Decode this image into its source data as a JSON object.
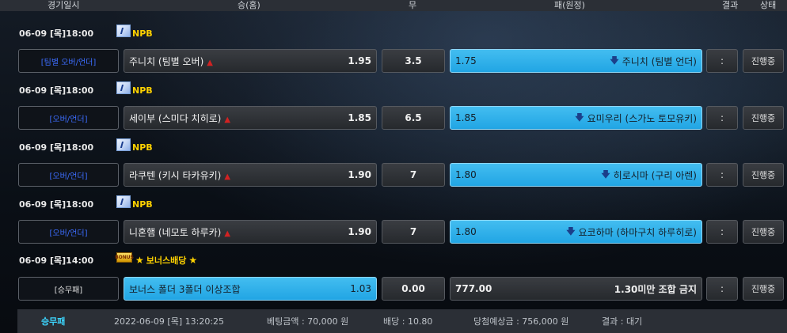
{
  "header": {
    "date": "경기일시",
    "home": "승(홈)",
    "draw": "무",
    "away": "패(원정)",
    "result": "결과",
    "status": "상태"
  },
  "games": [
    {
      "datetime": "06-09 [목]18:00",
      "league": "NPB",
      "bet_type": "[팀별 오버/언더]",
      "home_name": "주니치 (팀별 오버)",
      "home_odds": "1.95",
      "draw": "3.5",
      "away_odds": "1.75",
      "away_name": "주니치 (팀별 언더)",
      "result": ":",
      "status": "진행중"
    },
    {
      "datetime": "06-09 [목]18:00",
      "league": "NPB",
      "bet_type": "[오버/언더]",
      "home_name": "세이부 (스미다 치히로)",
      "home_odds": "1.85",
      "draw": "6.5",
      "away_odds": "1.85",
      "away_name": "요미우리 (스가노 토모유키)",
      "result": ":",
      "status": "진행중"
    },
    {
      "datetime": "06-09 [목]18:00",
      "league": "NPB",
      "bet_type": "[오버/언더]",
      "home_name": "라쿠텐 (키시 타카유키)",
      "home_odds": "1.90",
      "draw": "7",
      "away_odds": "1.80",
      "away_name": "히로시마 (구리 아렌)",
      "result": ":",
      "status": "진행중"
    },
    {
      "datetime": "06-09 [목]18:00",
      "league": "NPB",
      "bet_type": "[오버/언더]",
      "home_name": "니혼햄 (네모토 하루카)",
      "home_odds": "1.90",
      "draw": "7",
      "away_odds": "1.80",
      "away_name": "요코하마 (하마구치 하루히로)",
      "result": ":",
      "status": "진행중"
    }
  ],
  "bonus": {
    "datetime": "06-09 [목]14:00",
    "badge": "BONUS",
    "label": "보너스배당",
    "bet_type": "[승무패]",
    "home_name": "보너스 폴더 3폴더 이상조합",
    "home_odds": "1.03",
    "draw": "0.00",
    "away_odds": "777.00",
    "away_name": "1.30미만 조합 금지",
    "result": ":",
    "status": "진행중"
  },
  "footer": {
    "bet_type": "승무패",
    "time": "2022-06-09 [목] 13:20:25",
    "amount": "베팅금액 : 70,000 원",
    "odds": "배당 : 10.80",
    "win": "당첨예상금 : 756,000 원",
    "result": "결과 : 대기"
  },
  "colors": {
    "accent": "#2aaee8",
    "league": "#ffd200",
    "bet_type": "#3c6dff",
    "up": "#d22222",
    "down": "#1b3f8a"
  },
  "icons": {
    "up": "arrow-up-icon",
    "down": "arrow-down-icon",
    "flag": "japan-flag-icon",
    "star": "star-icon"
  }
}
